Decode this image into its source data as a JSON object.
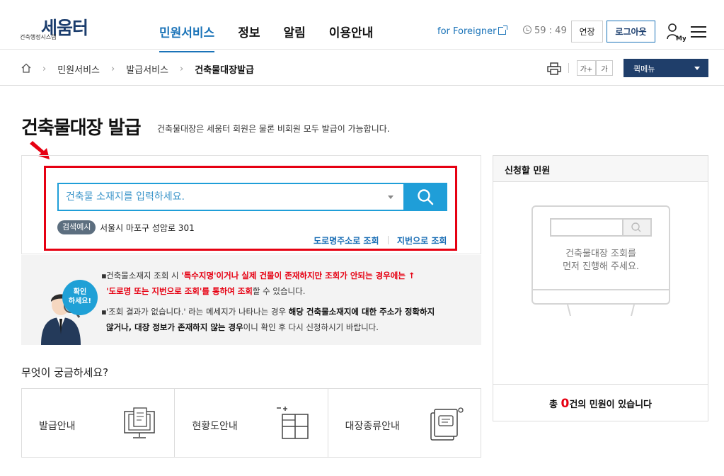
{
  "header": {
    "logo_main": "세움터",
    "logo_sub": "건축행정시스템",
    "nav": [
      "민원서비스",
      "정보",
      "알림",
      "이용안내"
    ],
    "foreigner": "for Foreigner",
    "timer": "59 : 49",
    "extend_label": "연장",
    "logout_label": "로그아웃",
    "my_label": "My"
  },
  "breadcrumb": {
    "items": [
      "민원서비스",
      "발급서비스",
      "건축물대장발급"
    ],
    "font_up": "가+",
    "font_down": "가",
    "quick_menu": "퀵메뉴"
  },
  "page": {
    "title": "건축물대장 발급",
    "description": "건축물대장은 세움터 회원은 물론 비회원 모두 발급이 가능합니다."
  },
  "search": {
    "placeholder": "건축물 소재지를 입력하세요.",
    "example_badge": "검색예시",
    "example_text": "서울시 마포구 성암로 301",
    "road_link": "도로명주소로 조회",
    "jibun_link": "지번으로 조회"
  },
  "notice": {
    "badge_line1": "확인",
    "badge_line2": "하세요!",
    "l1_a": "건축물소재지 조회 시 ",
    "l1_red": "'특수지명'이거나 실제 건물이 존재하지만 조회가 안되는 경우에는 ↑",
    "l2_red": "'도로명 또는 지번으로 조회'를 통하여 조회",
    "l2_b": "할 수 있습니다.",
    "l3_a": "'조회 결과가 없습니다.' 라는 메세지가 나타나는 경우 ",
    "l3_bold": "해당 건축물소재지에 대한 주소가 정확하지",
    "l4_bold": "않거나, 대장 정보가 존재하지 않는 경우",
    "l4_b": "이니 확인 후 다시 신청하시기 바랍니다."
  },
  "faq": {
    "title": "무엇이 궁금하세요?",
    "items": [
      "발급안내",
      "현황도안내",
      "대장종류안내"
    ]
  },
  "apply": {
    "title": "신청할 민원",
    "monitor_line1": "건축물대장 조회를",
    "monitor_line2": "먼저 진행해 주세요.",
    "foot_a": "총 ",
    "count": "0",
    "foot_b": "건의 민원이 있습니다"
  },
  "colors": {
    "brand_navy": "#1f3e6a",
    "accent_blue": "#1f9ed8",
    "highlight_red": "#e60012"
  }
}
